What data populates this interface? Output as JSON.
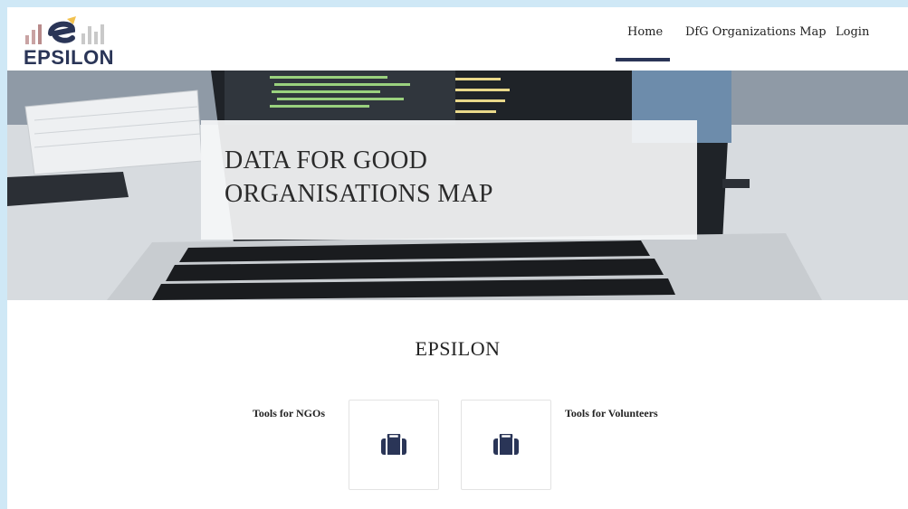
{
  "header": {
    "logo_text": "EPSILON",
    "nav": [
      {
        "label": "Home",
        "active": true
      },
      {
        "label": "DfG Organizations Map",
        "active": false
      },
      {
        "label": "Login",
        "active": false
      }
    ]
  },
  "hero": {
    "title_line1": "DATA FOR GOOD",
    "title_line2": "ORGANISATIONS MAP"
  },
  "main": {
    "section_title": "EPSILON",
    "tools": [
      {
        "label": "Tools for NGOs",
        "icon": "briefcase-icon"
      },
      {
        "label": "Tools for Volunteers",
        "icon": "briefcase-icon"
      }
    ]
  },
  "colors": {
    "brand_navy": "#2a3557",
    "accent_yellow": "#f2c14e",
    "background": "#cfe8f6"
  }
}
